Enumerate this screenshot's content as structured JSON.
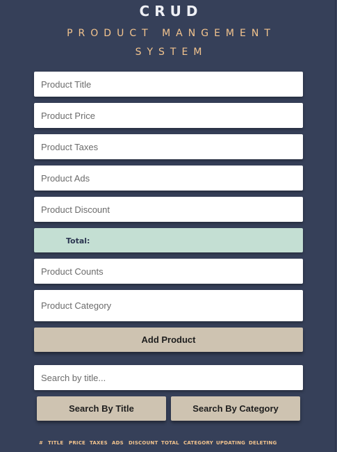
{
  "header": {
    "title": "CRUD",
    "subtitle_line1": "PRODUCT MANGEMENT",
    "subtitle_line2": "SYSTEM"
  },
  "form": {
    "title_placeholder": "Product Title",
    "price_placeholder": "Product Price",
    "taxes_placeholder": "Product Taxes",
    "ads_placeholder": "Product Ads",
    "discount_placeholder": "Product Discount",
    "total_label": "Total:",
    "count_placeholder": "Product Counts",
    "category_placeholder": "Product Category",
    "add_button": "Add Product"
  },
  "search": {
    "placeholder": "Search by title...",
    "by_title_button": "Search By Title",
    "by_category_button": "Search By Category"
  },
  "table": {
    "headers": [
      "#",
      "TITLE",
      "PRICE",
      "TAXES",
      "ADS",
      "DISCOUNT",
      "TOTAL",
      "CATEGORY",
      "UPDATING",
      "DELETING"
    ]
  },
  "colors": {
    "background": "#364059",
    "accent": "#f3c48e",
    "total_bg": "#c4dfd3",
    "button_bg": "#cec3b1"
  }
}
